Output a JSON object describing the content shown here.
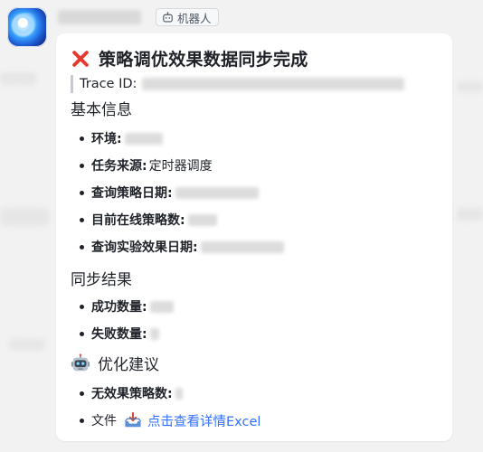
{
  "sender": {
    "bot_tag_label": "机器人"
  },
  "card": {
    "title": "策略调优效果数据同步完成",
    "trace_label": "Trace ID:",
    "sections": {
      "basic": "基本信息",
      "sync": "同步结果",
      "suggest": "优化建议"
    },
    "basic_items": {
      "env_label": "环境:",
      "source_label": "任务来源:",
      "source_value": "定时器调度",
      "query_date_label": "查询策略日期:",
      "online_count_label": "目前在线策略数:",
      "exp_date_label": "查询实验效果日期:"
    },
    "sync_items": {
      "success_label": "成功数量:",
      "fail_label": "失败数量:"
    },
    "suggest_items": {
      "invalid_label": "无效果策略数:",
      "file_label": "文件",
      "file_link": "点击查看详情Excel"
    }
  },
  "colors": {
    "link": "#3370ff",
    "cross": "#e8372c",
    "card_bg": "#ffffff",
    "page_bg": "#f2f2f2"
  },
  "icons": {
    "bot_tag": "robot-outline-icon",
    "title": "red-cross-icon",
    "suggest_section": "robot-face-icon",
    "file": "inbox-tray-icon"
  }
}
